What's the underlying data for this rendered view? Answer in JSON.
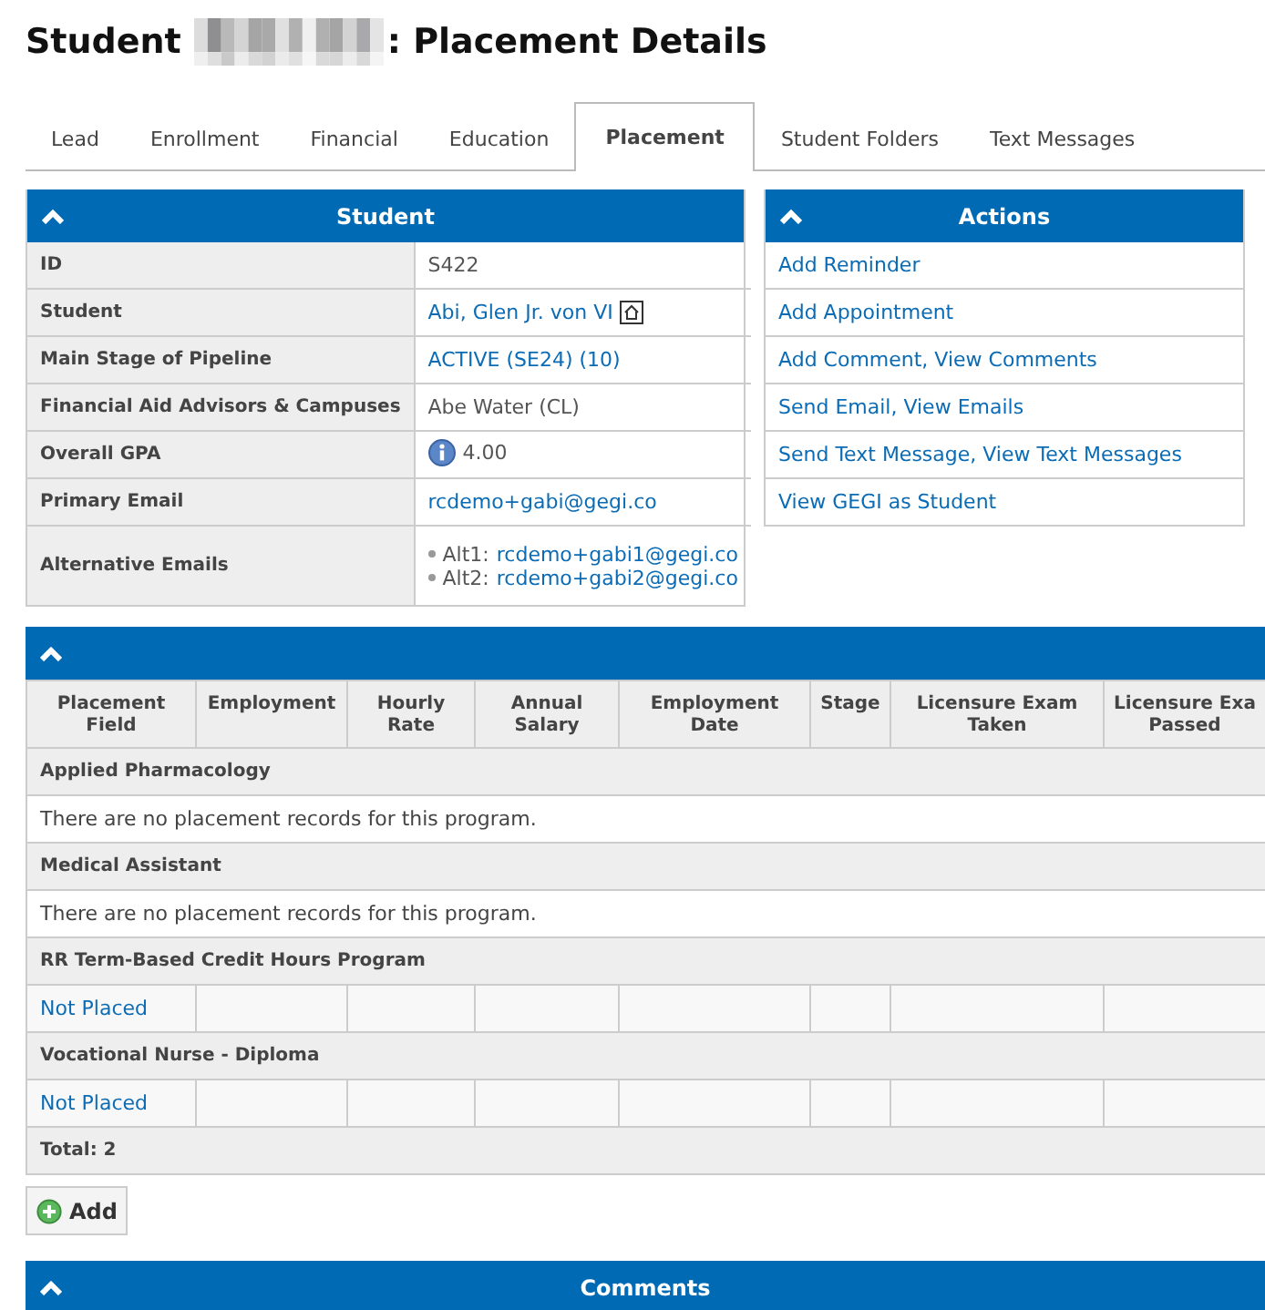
{
  "page_title": {
    "prefix": "Student",
    "suffix": ": Placement Details"
  },
  "tabs": [
    {
      "label": "Lead",
      "selected": false
    },
    {
      "label": "Enrollment",
      "selected": false
    },
    {
      "label": "Financial",
      "selected": false
    },
    {
      "label": "Education",
      "selected": false
    },
    {
      "label": "Placement",
      "selected": true
    },
    {
      "label": "Student Folders",
      "selected": false
    },
    {
      "label": "Text Messages",
      "selected": false
    }
  ],
  "student_panel": {
    "title": "Student",
    "rows": [
      {
        "label": "ID",
        "kind": "text",
        "value": "S422"
      },
      {
        "label": "Student",
        "kind": "home_link",
        "value": "Abi, Glen Jr. von VI"
      },
      {
        "label": "Main Stage of Pipeline",
        "kind": "link",
        "value": "ACTIVE (SE24) (10)"
      },
      {
        "label": "Financial Aid Advisors & Campuses",
        "kind": "text",
        "value": "Abe Water (CL)"
      },
      {
        "label": "Overall GPA",
        "kind": "info",
        "value": "4.00"
      },
      {
        "label": "Primary Email",
        "kind": "link",
        "value": "rcdemo+gabi@gegi.co"
      },
      {
        "label": "Alternative Emails",
        "kind": "emails",
        "items": [
          {
            "label": "Alt1:",
            "email": "rcdemo+gabi1@gegi.co"
          },
          {
            "label": "Alt2:",
            "email": "rcdemo+gabi2@gegi.co"
          }
        ]
      }
    ]
  },
  "actions_panel": {
    "title": "Actions",
    "items": [
      "Add Reminder",
      "Add Appointment",
      "Add Comment, View Comments",
      "Send Email, View Emails",
      "Send Text Message, View Text Messages",
      "View GEGI as Student"
    ]
  },
  "placement_table": {
    "columns": [
      {
        "lines": [
          "Placement",
          "Field"
        ]
      },
      {
        "lines": [
          "Employment"
        ]
      },
      {
        "lines": [
          "Hourly",
          "Rate"
        ]
      },
      {
        "lines": [
          "Annual",
          "Salary"
        ]
      },
      {
        "lines": [
          "Employment",
          "Date"
        ]
      },
      {
        "lines": [
          "Stage"
        ]
      },
      {
        "lines": [
          "Licensure Exam",
          "Taken"
        ]
      },
      {
        "lines": [
          "Licensure Exa",
          "Passed"
        ]
      }
    ],
    "groups": [
      {
        "name": "Applied Pharmacology",
        "kind": "empty",
        "message": "There are no placement records for this program."
      },
      {
        "name": "Medical Assistant",
        "kind": "empty",
        "message": "There are no placement records for this program."
      },
      {
        "name": "RR Term-Based Credit Hours Program",
        "kind": "records",
        "rows": [
          {
            "placement_field": "Not Placed"
          }
        ]
      },
      {
        "name": "Vocational Nurse - Diploma",
        "kind": "records",
        "rows": [
          {
            "placement_field": "Not Placed"
          }
        ]
      }
    ],
    "total": "Total: 2"
  },
  "add_button": {
    "label": "Add"
  },
  "comments_panel": {
    "title": "Comments"
  }
}
